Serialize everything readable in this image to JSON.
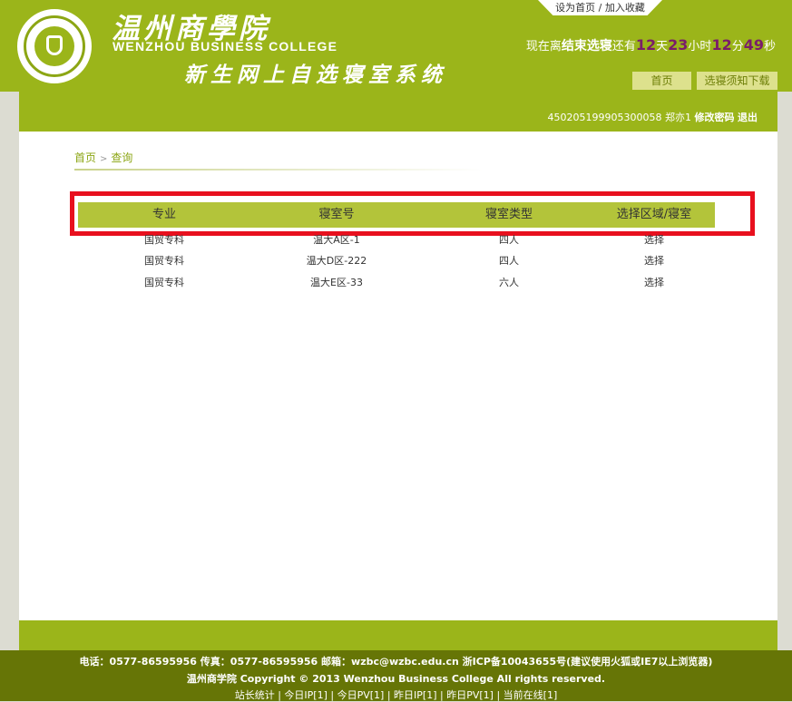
{
  "top_links": {
    "set_home": "设为首页",
    "sep": " / ",
    "add_fav": "加入收藏"
  },
  "header": {
    "college_cn": "温州商學院",
    "college_en": "WENZHOU BUSINESS COLLEGE",
    "system_title": "新生网上自选寝室系统"
  },
  "countdown": {
    "prefix": "现在离",
    "event": "结束选寝",
    "remain": "还有",
    "days": "12",
    "days_unit": "天",
    "hours": "23",
    "hours_unit": "小时",
    "minutes": "12",
    "minutes_unit": "分",
    "seconds": "49",
    "seconds_unit": "秒"
  },
  "nav": {
    "home": "首页",
    "download": "选寝须知下载"
  },
  "user": {
    "id": "450205199905300058",
    "name": "郑亦1",
    "change_password": "修改密码",
    "logout": "退出"
  },
  "breadcrumb": {
    "home": "首页",
    "sep": ">",
    "current": "查询"
  },
  "table": {
    "headers": [
      "专业",
      "寝室号",
      "寝室类型",
      "选择区域/寝室"
    ],
    "rows": [
      {
        "major": "国贸专科",
        "room": "温大A区-1",
        "type": "四人",
        "action": "选择"
      },
      {
        "major": "国贸专科",
        "room": "温大D区-222",
        "type": "四人",
        "action": "选择"
      },
      {
        "major": "国贸专科",
        "room": "温大E区-33",
        "type": "六人",
        "action": "选择"
      }
    ]
  },
  "footer": {
    "line1": "电话：0577-86595956 传真：0577-86595956 邮箱：wzbc@wzbc.edu.cn 浙ICP备10043655号(建议使用火狐或IE7以上浏览器)",
    "line2": "温州商学院 Copyright © 2013 Wenzhou Business College All rights reserved.",
    "stats": [
      "站长统计",
      "今日IP[1]",
      "今日PV[1]",
      "昨日IP[1]",
      "昨日PV[1]",
      "当前在线[1]"
    ],
    "stats_sep": " | "
  },
  "colors": {
    "brand_green": "#9bb51a",
    "footer_green": "#667506",
    "countdown_num": "#7a1d6a",
    "highlight_red": "#e8101e"
  }
}
